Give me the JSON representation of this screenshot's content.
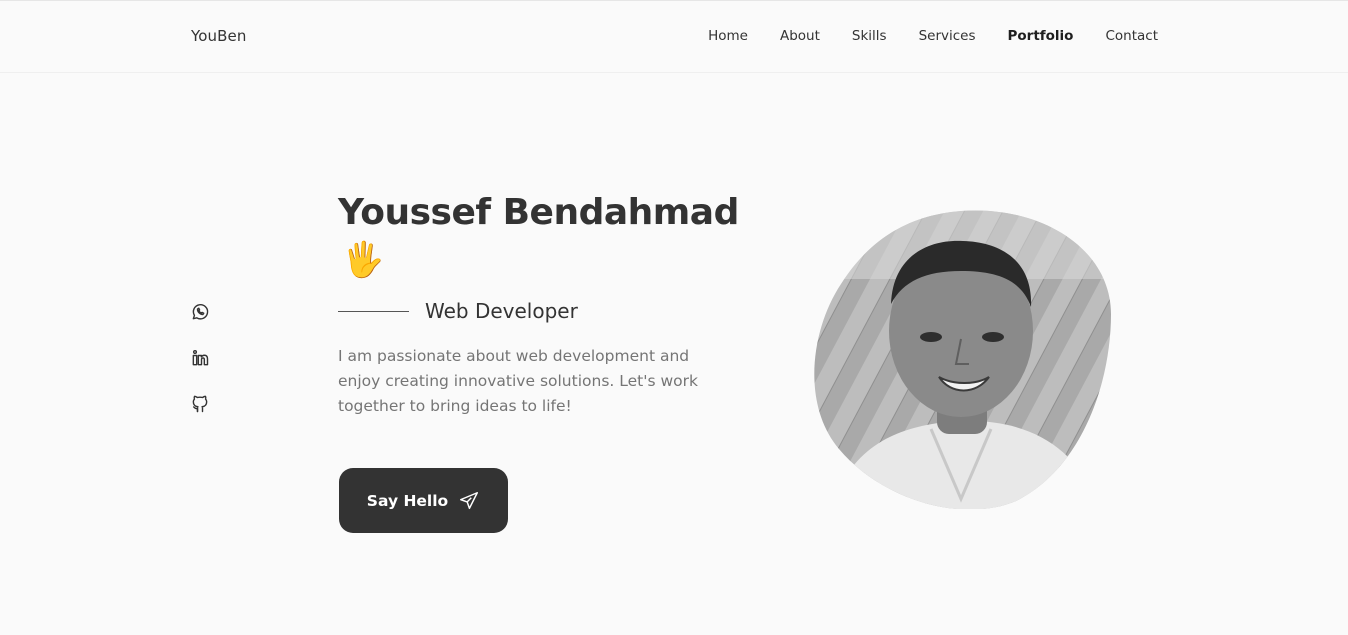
{
  "header": {
    "logo": "YouBen",
    "nav": [
      {
        "label": "Home",
        "active": false
      },
      {
        "label": "About",
        "active": false
      },
      {
        "label": "Skills",
        "active": false
      },
      {
        "label": "Services",
        "active": false
      },
      {
        "label": "Portfolio",
        "active": true
      },
      {
        "label": "Contact",
        "active": false
      }
    ]
  },
  "social": {
    "icons": [
      "whatsapp-icon",
      "linkedin-icon",
      "github-icon"
    ]
  },
  "hero": {
    "name": "Youssef Bendahmad",
    "wave": "🖐",
    "role": "Web Developer",
    "description": "I am passionate about web development and enjoy creating innovative solutions. Let's work together to bring ideas to life!",
    "button_label": "Say Hello",
    "button_icon": "send-icon",
    "photo": "profile-photo"
  },
  "colors": {
    "background": "#fafafa",
    "text": "#333333",
    "muted": "#757575",
    "button": "#333333"
  }
}
